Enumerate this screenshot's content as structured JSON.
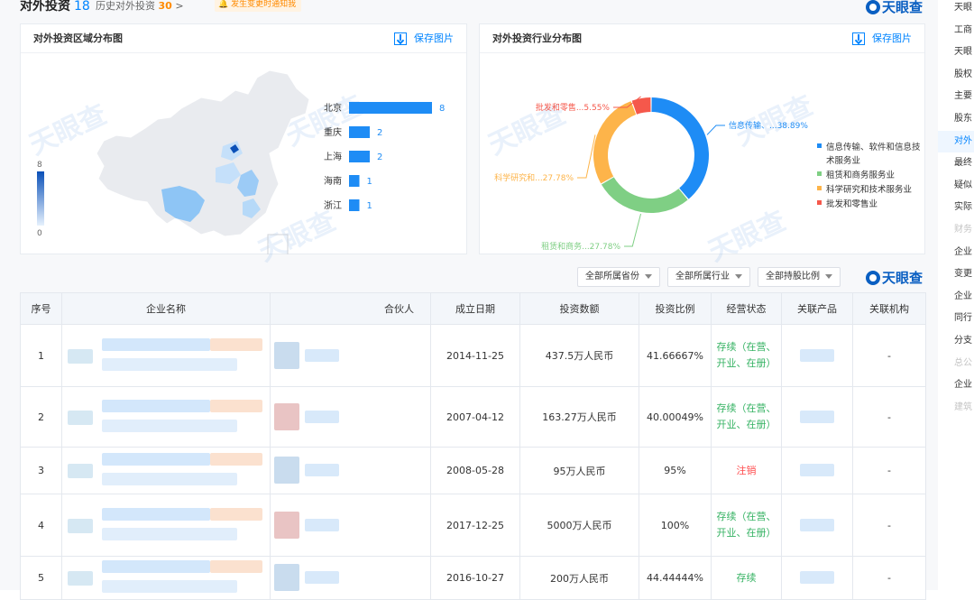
{
  "header": {
    "title": "对外投资",
    "count": "18",
    "history_label": "历史对外投资",
    "history_count": "30",
    "history_arrow": ">",
    "notify_label": "发生变更时通知我"
  },
  "logo_text": "天眼查",
  "watermark_text": "天眼查",
  "region_card": {
    "title": "对外投资区域分布图",
    "save_label": "保存图片",
    "legend_max": "8",
    "legend_min": "0"
  },
  "industry_card": {
    "title": "对外投资行业分布图",
    "save_label": "保存图片"
  },
  "chart_data": [
    {
      "type": "bar",
      "categories": [
        "北京",
        "重庆",
        "上海",
        "海南",
        "浙江"
      ],
      "values": [
        8,
        2,
        2,
        1,
        1
      ],
      "title": "",
      "color": "#1e8cf5"
    },
    {
      "type": "pie",
      "categories": [
        "信息传输、软件和信息技术服务业",
        "租赁和商务服务业",
        "科学研究和技术服务业",
        "批发和零售业"
      ],
      "values": [
        38.89,
        27.78,
        27.78,
        5.55
      ],
      "slice_labels": [
        "信息传输、...38.89%",
        "租赁和商务...27.78%",
        "科学研究和...27.78%",
        "批发和零售...5.55%"
      ],
      "colors": [
        "#1e8cf5",
        "#7fcf84",
        "#fdb44a",
        "#f5584b"
      ],
      "legend_position": "right"
    }
  ],
  "filters": [
    {
      "label": "全部所属省份"
    },
    {
      "label": "全部所属行业"
    },
    {
      "label": "全部持股比例"
    }
  ],
  "table": {
    "headers": [
      "序号",
      "企业名称",
      "合伙人",
      "成立日期",
      "投资数额",
      "投资比例",
      "经营状态",
      "关联产品",
      "关联机构"
    ],
    "rows": [
      {
        "no": "1",
        "date": "2014-11-25",
        "amount": "437.5万人民币",
        "ratio": "41.66667%",
        "status": "存续（在营、开业、在册）",
        "org": "-"
      },
      {
        "no": "2",
        "date": "2007-04-12",
        "amount": "163.27万人民币",
        "ratio": "40.00049%",
        "status": "存续（在营、开业、在册）",
        "org": "-"
      },
      {
        "no": "3",
        "date": "2008-05-28",
        "amount": "95万人民币",
        "ratio": "95%",
        "status": "注销",
        "org": "-"
      },
      {
        "no": "4",
        "date": "2017-12-25",
        "amount": "5000万人民币",
        "ratio": "100%",
        "status": "存续（在营、开业、在册）",
        "org": "-"
      },
      {
        "no": "5",
        "date": "2016-10-27",
        "amount": "200万人民币",
        "ratio": "44.44444%",
        "status": "存续",
        "org": "-"
      }
    ]
  },
  "sidebar": {
    "items": [
      "天眼",
      "工商",
      "天眼",
      "股权",
      "主要",
      "股东",
      "对外",
      "最终",
      "疑似",
      "实际",
      "财务",
      "企业",
      "变更",
      "企业",
      "同行",
      "分支",
      "总公",
      "企业",
      "建筑"
    ]
  }
}
